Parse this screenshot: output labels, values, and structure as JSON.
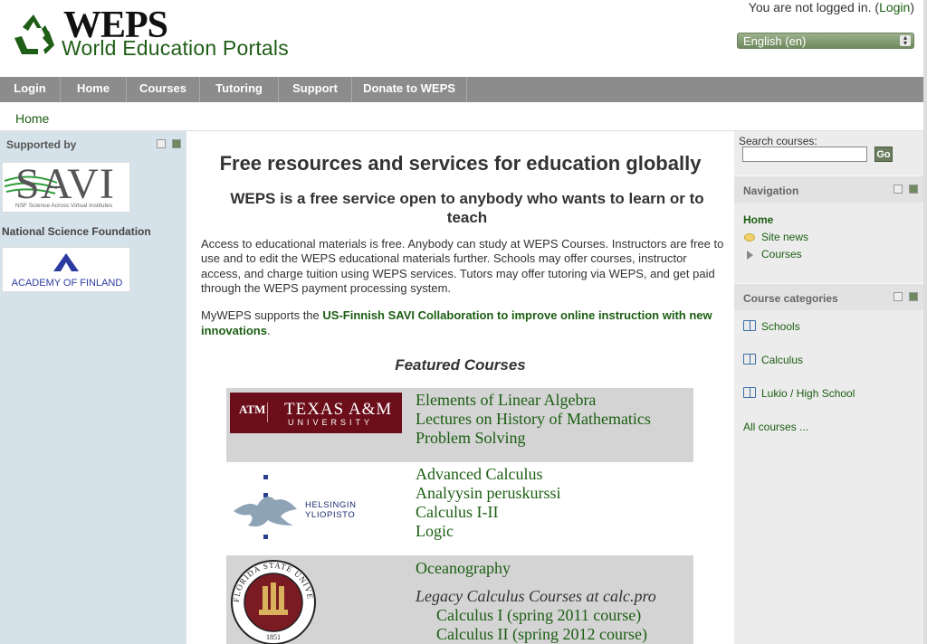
{
  "header": {
    "logo_title": "WEPS",
    "logo_subtitle": "World Education Portals",
    "login_prefix": "You are not logged in. (",
    "login_link": "Login",
    "login_suffix": ")",
    "language": "English (en)"
  },
  "nav": [
    "Login",
    "Home",
    "Courses",
    "Tutoring",
    "Support",
    "Donate to WEPS"
  ],
  "breadcrumb": "Home",
  "left": {
    "block_title": "Supported by",
    "savi_text": "SAVI",
    "savi_tagline": "NSF Science Across Virtual Institutes",
    "nsf_label": "National Science Foundation",
    "aof_text": "ACADEMY OF FINLAND"
  },
  "main": {
    "title": "Free resources and services for education globally",
    "subtitle": "WEPS is a free service open to anybody who wants to learn or to teach",
    "paragraph": "Access to educational materials is free. Anybody can study at WEPS Courses. Instructors are free to use and to edit the WEPS educational materials further. Schools may offer courses, instructor access, and charge tuition using WEPS services. Tutors may offer tutoring via WEPS, and get paid through the WEPS payment processing system.",
    "myweps_prefix": "MyWEPS supports the ",
    "myweps_link": "US-Finnish SAVI Collaboration to improve online instruction with new innovations",
    "myweps_suffix": ".",
    "featured_title": "Featured Courses",
    "tamu_logo_text": "TEXAS A&M",
    "tamu_logo_sub": "UNIVERSITY",
    "tamu_mark": "ATM",
    "helsinki_logo_text": "HELSINGIN YLIOPISTO",
    "fsu_ring_text": "FLORIDA STATE UNIVERSITY",
    "fsu_year": "1851",
    "tamu_courses": [
      "Elements of Linear Algebra",
      "Lectures on History of Mathematics",
      "Problem Solving"
    ],
    "helsinki_courses": [
      "Advanced Calculus",
      "Analyysin peruskurssi",
      "Calculus I-II",
      "Logic"
    ],
    "fsu_course": "Oceanography",
    "fsu_legacy": "Legacy Calculus Courses at calc.pro",
    "fsu_legacy_courses": [
      "Calculus I (spring 2011 course)",
      "Calculus II (spring 2012 course)"
    ]
  },
  "right": {
    "search_label": "Search courses:",
    "search_value": "",
    "search_button": "Go",
    "navigation_title": "Navigation",
    "nav_home": "Home",
    "nav_site_news": "Site news",
    "nav_courses": "Courses",
    "categories_title": "Course categories",
    "categories": [
      "Schools",
      "Calculus",
      "Lukio / High School"
    ],
    "all_courses": "All courses ..."
  },
  "colors": {
    "accent_green": "#1b5e12",
    "navbar_gray": "#8c8c8c",
    "left_column_blue": "#d6e2ea",
    "tamu_maroon": "#6b0e1a",
    "featured_row_gray": "#d4d4d4"
  }
}
